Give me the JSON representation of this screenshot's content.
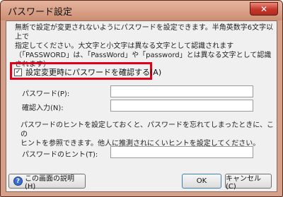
{
  "window": {
    "title": "パスワード設定",
    "close_label": "✕"
  },
  "description": {
    "lines": [
      "無断で設定が変更されないようにパスワードを設定できます。半角英数字6文字以上で",
      "指定してください。大文字と小文字は異なる文字として認識されます",
      "（「PASSWORD」は、「PassWord」や「password」とは異なる文字として認識されます）"
    ]
  },
  "confirm_checkbox": {
    "label": "設定変更時にパスワードを確認する(A)",
    "checked": true,
    "mark": "✓"
  },
  "password_field": {
    "label": "パスワード(P):",
    "value": ""
  },
  "confirm_field": {
    "label": "確認入力(N):",
    "value": ""
  },
  "hint_description": {
    "lines": [
      "パスワードのヒントを設定しておくと、パスワードを忘れてしまったときに、この",
      "ヒントを参照できます。他人に推測されにくいヒントを設定してください。"
    ]
  },
  "hint_field": {
    "label": "パスワードのヒント(T):",
    "value": ""
  },
  "buttons": {
    "help_icon": "?",
    "help": "この画面の説明(H)",
    "ok": "OK",
    "cancel": "キャンセル(C)"
  },
  "colors": {
    "highlight": "#e0001b",
    "titlebar": "#cc8e73",
    "close_button": "#c3372a"
  }
}
